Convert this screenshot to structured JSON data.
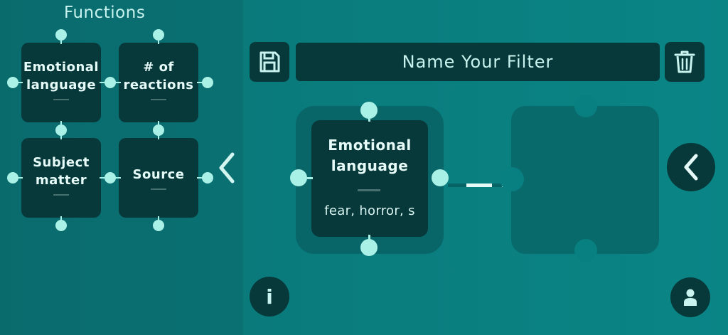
{
  "sidebar": {
    "title": "Functions",
    "cards": [
      {
        "label": "Emotional\nlanguage"
      },
      {
        "label": "# of\nreactions"
      },
      {
        "label": "Subject\nmatter"
      },
      {
        "label": "Source"
      }
    ]
  },
  "toolbar": {
    "filter_name_placeholder": "Name Your Filter",
    "filter_name_value": ""
  },
  "canvas": {
    "active_card": {
      "title": "Emotional\nlanguage",
      "subtitle": "fear, horror, s"
    }
  },
  "footer": {
    "info_label": "i"
  },
  "icons": {
    "save": "save-icon",
    "trash": "trash-icon",
    "collapse": "chevron-left-icon",
    "back": "chevron-left-icon",
    "profile": "person-icon"
  },
  "colors": {
    "panel": "#0a6b6d",
    "background": "#087f80",
    "card": "#07393b",
    "accent": "#a9f1e6"
  }
}
